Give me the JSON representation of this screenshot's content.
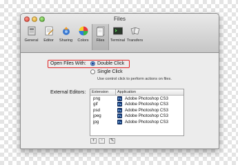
{
  "window": {
    "title": "Files"
  },
  "toolbar": {
    "items": [
      {
        "label": "General",
        "icon": "general-icon"
      },
      {
        "label": "Editor",
        "icon": "editor-icon"
      },
      {
        "label": "Sharing",
        "icon": "sharing-icon"
      },
      {
        "label": "Colors",
        "icon": "colors-icon"
      },
      {
        "label": "Files",
        "icon": "files-icon",
        "selected": true
      },
      {
        "label": "Terminal",
        "icon": "terminal-icon"
      },
      {
        "label": "Transfers",
        "icon": "transfers-icon"
      }
    ]
  },
  "open_files": {
    "label": "Open Files With:",
    "options": [
      {
        "label": "Double Click",
        "selected": true
      },
      {
        "label": "Single Click",
        "selected": false
      }
    ],
    "hint": "Use control click to perform actions on files."
  },
  "external_editors": {
    "label": "External Editors:",
    "columns": [
      "Extension",
      "Application"
    ],
    "rows": [
      {
        "extension": "png",
        "application": "Adobe Photoshop CS3"
      },
      {
        "extension": "gif",
        "application": "Adobe Photoshop CS3"
      },
      {
        "extension": "psd",
        "application": "Adobe Photoshop CS3"
      },
      {
        "extension": "jpeg",
        "application": "Adobe Photoshop CS3"
      },
      {
        "extension": "jpg",
        "application": "Adobe Photoshop CS3"
      }
    ],
    "app_icon_text": "Ps",
    "buttons": {
      "add": "+",
      "remove": "−",
      "edit": "✎"
    }
  },
  "colors": {
    "highlight_box": "#e02020",
    "selected_radio": "#5d8fd8"
  }
}
